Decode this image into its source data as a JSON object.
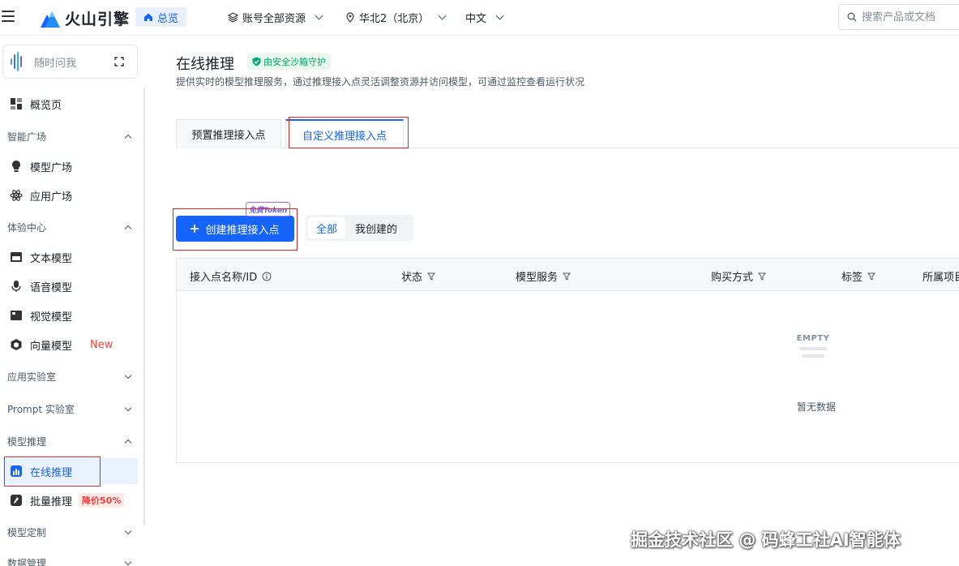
{
  "topbar": {
    "brand": "火山引擎",
    "home_label": "总览",
    "resources_label": "账号全部资源",
    "region_label": "华北2（北京）",
    "language_label": "中文",
    "search_placeholder": "搜索产品或文档"
  },
  "sidebar": {
    "ask_label": "随时问我",
    "overview": "概览页",
    "groups": {
      "smart_plaza": "智能广场",
      "experience": "体验中心",
      "app_lab": "应用实验室",
      "prompt_lab": "Prompt 实验室",
      "model_infer": "模型推理",
      "model_custom": "模型定制",
      "data_mgmt": "数据管理"
    },
    "items": {
      "model_plaza": "模型广场",
      "app_plaza": "应用广场",
      "text_model": "文本模型",
      "voice_model": "语音模型",
      "vision_model": "视觉模型",
      "vector_model": "向量模型",
      "vector_new_tag": "New",
      "online_infer": "在线推理",
      "batch_infer": "批量推理",
      "batch_discount_tag": "降价50%"
    }
  },
  "main": {
    "title": "在线推理",
    "safe_badge": "由安全沙箱守护",
    "subtitle": "提供实时的模型推理服务，通过推理接入点灵活调整资源并访问模型，可通过监控查看运行状况",
    "tabs": {
      "preset": "预置推理接入点",
      "custom": "自定义推理接入点"
    },
    "create_button": "创建推理接入点",
    "free_token_tag": "免费Token",
    "filter": {
      "all": "全部",
      "mine": "我创建的"
    },
    "columns": {
      "name": "接入点名称/ID",
      "status": "状态",
      "service": "模型服务",
      "purchase": "购买方式",
      "tags": "标签",
      "project": "所属项目"
    },
    "empty_label": "EMPTY",
    "empty_text": "暂无数据"
  },
  "watermark": "掘金技术社区 @ 码蜂工社AI智能体",
  "colors": {
    "accent": "#1664ff",
    "highlight_box": "#e0262b",
    "new_tag": "#f53f3f"
  }
}
